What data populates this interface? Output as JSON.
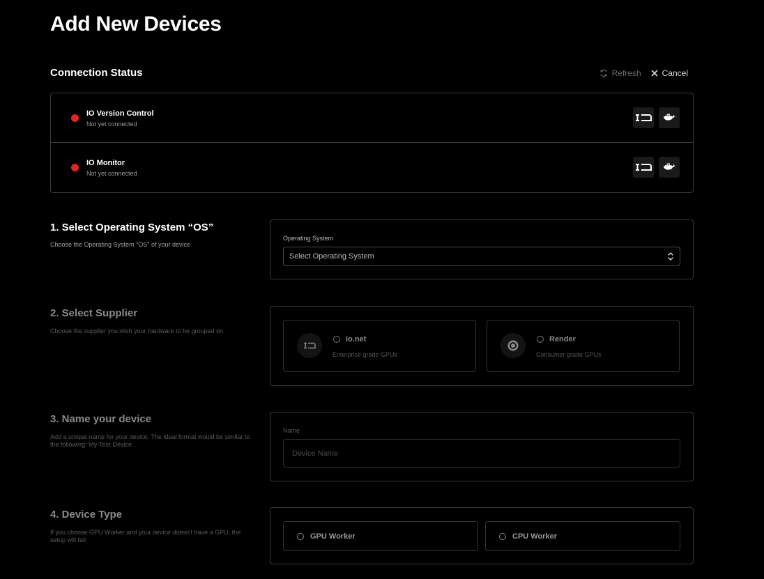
{
  "page": {
    "title": "Add New Devices"
  },
  "connection": {
    "title": "Connection Status",
    "refresh_label": "Refresh",
    "cancel_label": "Cancel",
    "items": [
      {
        "name": "IO Version Control",
        "status": "Not yet connected",
        "status_color": "#e02424"
      },
      {
        "name": "IO Monitor",
        "status": "Not yet connected",
        "status_color": "#e02424"
      }
    ]
  },
  "step1": {
    "title": "1. Select Operating System “OS”",
    "description": "Choose the Operating System \"OS\" of your device",
    "field_label": "Operating System",
    "select_value": "Select Operating System"
  },
  "step2": {
    "title": "2. Select Supplier",
    "description": "Choose the supplier you wish your hardware to be grouped on",
    "options": [
      {
        "name": "io.net",
        "subtitle": "Enterprise grade GPUs",
        "icon": "io-net-logo-icon"
      },
      {
        "name": "Render",
        "subtitle": "Consumer grade GPUs",
        "icon": "render-logo-icon"
      }
    ]
  },
  "step3": {
    "title": "3. Name your device",
    "description": "Add a unique name for your device. The ideal format would be similar to the following: My-Test-Device",
    "field_label": "Name",
    "placeholder": "Device Name",
    "value": ""
  },
  "step4": {
    "title": "4. Device Type",
    "description": "If you choose GPU Worker and your device doesn't have a GPU, the setup will fail",
    "options": [
      {
        "label": "GPU Worker"
      },
      {
        "label": "CPU Worker"
      }
    ]
  },
  "colors": {
    "background": "#000000",
    "border": "#3a3a3a",
    "status_red": "#e02424"
  }
}
